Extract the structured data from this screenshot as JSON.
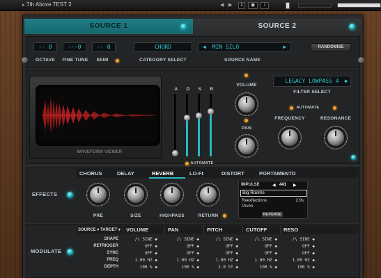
{
  "host": {
    "title": "7th Above TEST 2",
    "box_label": "1"
  },
  "tabs": {
    "source1": "SOURCE 1",
    "source2": "SOURCE 2"
  },
  "tuning": {
    "octave_value": "-- 0",
    "finetune_value": "---0",
    "semi_value": "-- 0",
    "octave_label": "OCTAVE",
    "finetune_label": "FINE TUNE",
    "semi_label": "SEMI"
  },
  "category": {
    "value": "CHORD",
    "label": "CATEGORY SELECT"
  },
  "source_name": {
    "value": "MIN SILO",
    "prev": "◀",
    "next": "▶",
    "label": "SOURCE NAME"
  },
  "randomise_label": "RANDOMISE",
  "waveform_label": "WAVEFORM VIEWER",
  "adsr": {
    "labels": [
      "A",
      "D",
      "S",
      "R"
    ],
    "levels": [
      0.05,
      0.62,
      0.66,
      0.72
    ],
    "automate_label": "AUTOMATE"
  },
  "volume_label": "VOLUME",
  "pan_label": "PAN",
  "filter": {
    "value": "LEGACY LOWPASS 4",
    "label": "FILTER SELECT",
    "automate_label": "AUTOMATE",
    "frequency_label": "FREQUENCY",
    "resonance_label": "RESONANCE"
  },
  "effects": {
    "section_label": "EFFECTS",
    "tabs": [
      "CHORUS",
      "DELAY",
      "REVERB",
      "LO-FI",
      "DISTORT",
      "PORTAMENTO"
    ],
    "active_tab": "REVERB",
    "knobs": [
      "PRE",
      "SIZE",
      "HIGHPASS",
      "RETURN"
    ],
    "impulse_label": "IMPULSE",
    "impulse_value": "441",
    "impulse_list": [
      "Big Rooms",
      "Reexflections",
      "Orven"
    ],
    "impulse_time": "2.9s",
    "reverse_label": "REVERSE"
  },
  "modulate": {
    "section_label": "MODULATE",
    "source_target_label": "SOURCE ▾ TARGET ▾",
    "columns": [
      "VOLUME",
      "PAN",
      "PITCH",
      "CUTOFF",
      "RESO"
    ],
    "rows": [
      {
        "label": "SHAPE",
        "values": [
          "/\\ SINE ◆",
          "/\\ SINE ◆",
          "/\\ SINE ◆",
          "/\\ SINE ◆",
          "/\\ SINE ◆"
        ]
      },
      {
        "label": "RETRIGGER",
        "values": [
          "OFF ◆",
          "OFF ◆",
          "OFF ◆",
          "OFF ◆",
          "OFF ◆"
        ]
      },
      {
        "label": "SYNC",
        "values": [
          "OFF ◆",
          "OFF ◆",
          "OFF ◆",
          "OFF ◆",
          "OFF ◆"
        ]
      },
      {
        "label": "FREQ",
        "values": [
          "1.00 HZ ◆",
          "1.00 HZ ◆",
          "1.00 HZ ◆",
          "1.00 HZ ◆",
          "1.00 HZ ◆"
        ]
      },
      {
        "label": "DEPTH",
        "values": [
          "100 % ◆",
          "100 % ◆",
          "2.0 ST ◆",
          "100 % ◆",
          "100 % ◆"
        ]
      }
    ]
  },
  "colors": {
    "accent": "#1f7d86",
    "lcd_text": "#31c6cf",
    "led_orange": "#f2a329"
  }
}
